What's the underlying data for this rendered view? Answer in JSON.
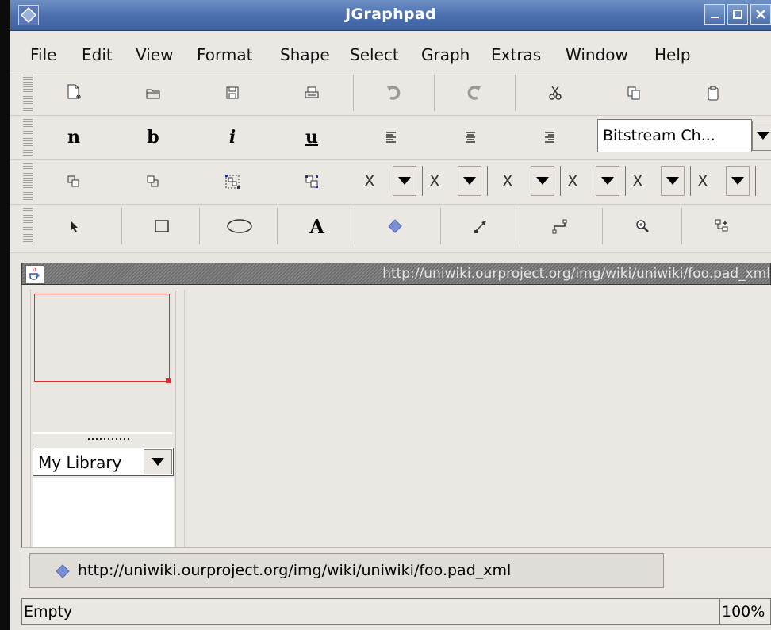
{
  "window": {
    "title": "JGraphpad",
    "buttons": [
      "minimize",
      "maximize",
      "close"
    ]
  },
  "menu": [
    "File",
    "Edit",
    "View",
    "Format",
    "Shape",
    "Select",
    "Graph",
    "Extras",
    "Window",
    "Help"
  ],
  "toolbar_file": [
    {
      "icon": "new-document-icon"
    },
    {
      "icon": "open-folder-icon"
    },
    {
      "icon": "save-disk-icon"
    },
    {
      "icon": "print-icon"
    },
    {
      "icon": "undo-icon"
    },
    {
      "icon": "redo-icon"
    },
    {
      "icon": "cut-icon"
    },
    {
      "icon": "copy-icon"
    },
    {
      "icon": "paste-icon"
    }
  ],
  "toolbar_format": {
    "text_buttons": [
      "n",
      "b",
      "i",
      "u"
    ],
    "align_icons": [
      "align-left-icon",
      "align-center-icon",
      "align-right-icon"
    ],
    "font_combo_value": "Bitstream Ch..."
  },
  "toolbar_arrange": {
    "icons": [
      "to-front-icon",
      "to-back-icon",
      "group-icon",
      "ungroup-icon"
    ],
    "selectors": [
      "X",
      "X",
      "X",
      "X",
      "X",
      "X"
    ]
  },
  "toolbar_tools": {
    "text_tool_label": "A",
    "icons": [
      "select-arrow-icon",
      "rectangle-icon",
      "ellipse-icon",
      "text-icon",
      "diamond-icon",
      "edge-icon",
      "orthogonal-edge-icon",
      "zoom-icon",
      "insert-graph-icon"
    ]
  },
  "document": {
    "frame_title": "http://uniwiki.ourproject.org/img/wiki/uniwiki/foo.pad_xml",
    "tab_label": "http://uniwiki.ourproject.org/img/wiki/uniwiki/foo.pad_xml"
  },
  "library": {
    "selected": "My Library"
  },
  "status": {
    "message": "Empty",
    "zoom": "100%"
  }
}
